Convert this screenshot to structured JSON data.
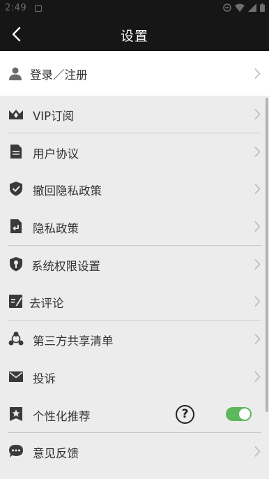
{
  "status_bar": {
    "time": "2:49"
  },
  "header": {
    "title": "设置"
  },
  "login": {
    "label": "登录／注册"
  },
  "items": [
    {
      "id": "vip",
      "label": "VIP订阅",
      "icon": "vip-crown-icon"
    },
    {
      "id": "agreement",
      "label": "用户协议",
      "icon": "document-icon"
    },
    {
      "id": "revoke-privacy",
      "label": "撤回隐私政策",
      "icon": "shield-check-icon"
    },
    {
      "id": "privacy",
      "label": "隐私政策",
      "icon": "privacy-return-icon"
    },
    {
      "id": "permissions",
      "label": "系统权限设置",
      "icon": "shield-key-icon"
    },
    {
      "id": "comment",
      "label": "去评论",
      "icon": "edit-note-icon"
    },
    {
      "id": "third-party",
      "label": "第三方共享清单",
      "icon": "share-nodes-icon"
    },
    {
      "id": "complaint",
      "label": "投诉",
      "icon": "mail-icon"
    },
    {
      "id": "personalized",
      "label": "个性化推荐",
      "icon": "star-badge-icon",
      "toggle_on": true
    },
    {
      "id": "feedback",
      "label": "意见反馈",
      "icon": "chat-bubble-icon"
    }
  ],
  "colors": {
    "toggle_on": "#5cb85c",
    "header_bg": "#161616",
    "list_bg": "#ececec"
  }
}
